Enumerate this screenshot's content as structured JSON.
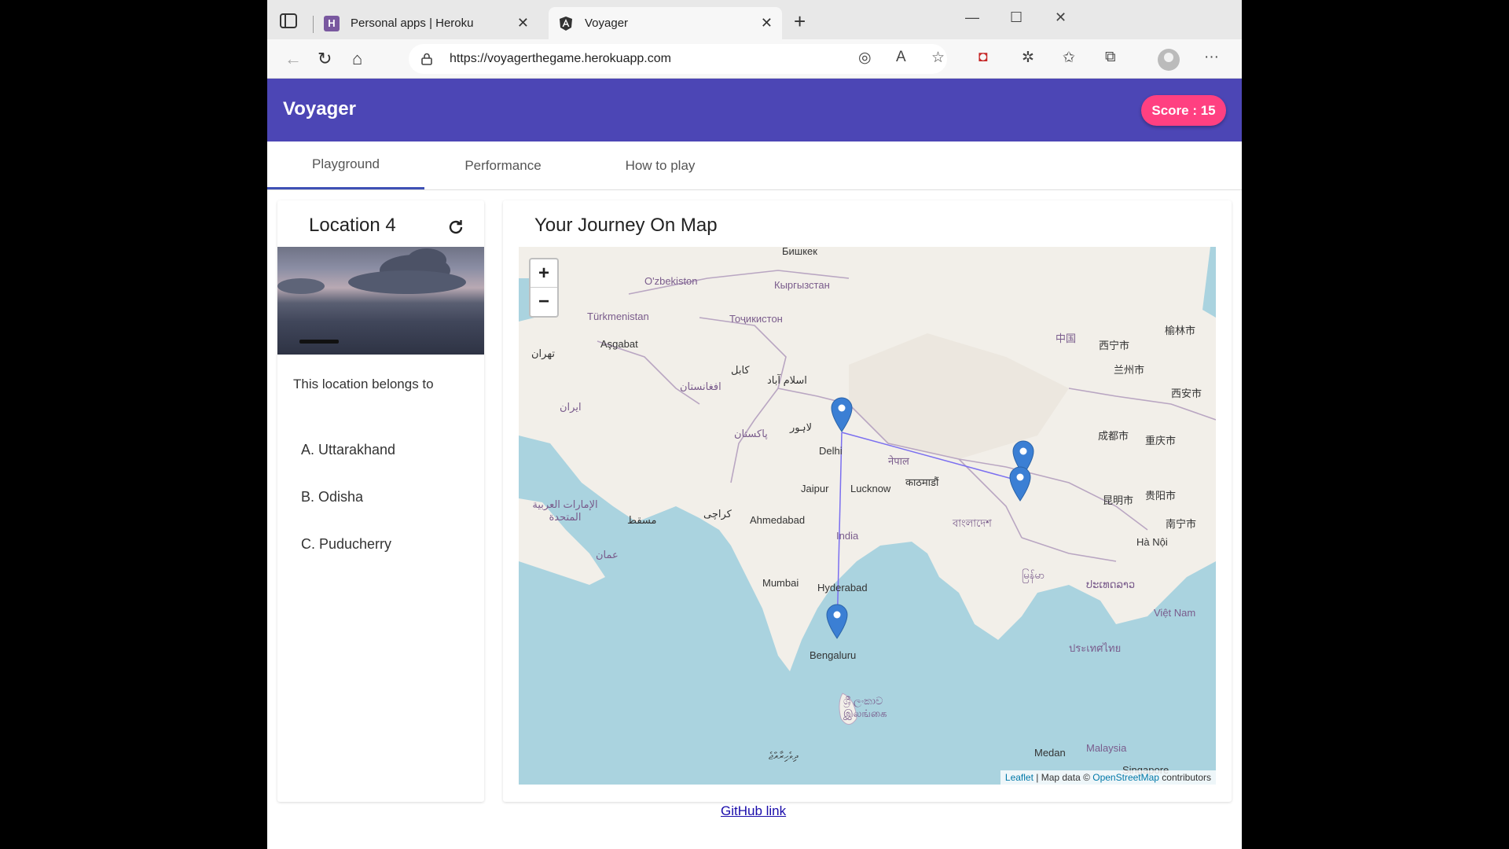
{
  "browser": {
    "tabs": [
      {
        "title": "Personal apps | Heroku",
        "favicon": "heroku-icon",
        "active": false
      },
      {
        "title": "Voyager",
        "favicon": "angular-icon",
        "active": true
      }
    ],
    "url": "https://voyagerthegame.herokuapp.com"
  },
  "app": {
    "title": "Voyager",
    "score_label": "Score : 15",
    "accent": "#4c46b5",
    "score_color": "#ff4081"
  },
  "nav": {
    "tabs": [
      {
        "label": "Playground",
        "selected": true
      },
      {
        "label": "Performance",
        "selected": false
      },
      {
        "label": "How to play",
        "selected": false
      }
    ]
  },
  "question": {
    "title": "Location 4",
    "prompt": "This location belongs to",
    "options": [
      "A. Uttarakhand",
      "B. Odisha",
      "C. Puducherry"
    ]
  },
  "map": {
    "title": "Your Journey On Map",
    "zoom_in": "+",
    "zoom_out": "−",
    "attribution": {
      "leaflet": "Leaflet",
      "middle": " | Map data © ",
      "osm": "OpenStreetMap",
      "end": " contributors"
    },
    "labels": {
      "bishkek": "Бишкек",
      "uzbekistan": "O'zbekiston",
      "kyrgyzstan": "Кыргызстан",
      "turkmenistan": "Türkmenistan",
      "tajikistan": "Тоҷикистон",
      "ashgabat": "Aşgabat",
      "china": "中国",
      "xining": "西宁市",
      "lanzhou": "兰州市",
      "xian": "西安市",
      "yulin": "榆林市",
      "kabul": "كابل",
      "afghanistan": "افغانستان",
      "islamabad": "اسلام آباد",
      "tehran": "تهران",
      "iran": "ایران",
      "pakistan": "پاکستان",
      "lahore": "لاہور",
      "delhi": "Delhi",
      "nepal": "नेपाल",
      "kathmandu": "काठमाडौं",
      "chengdu": "成都市",
      "chongqing": "重庆市",
      "jaipur": "Jaipur",
      "lucknow": "Lucknow",
      "karachi": "کراچی",
      "ahmedabad": "Ahmedabad",
      "uae": "الإمارات العربية المتحدة",
      "muscat": "مسقط",
      "oman": "عمان",
      "india": "India",
      "bangladesh": "বাংলাদেশ",
      "kunming": "昆明市",
      "guiyang": "贵阳市",
      "nanning": "南宁市",
      "hanoi": "Hà Nội",
      "mumbai": "Mumbai",
      "hyderabad": "Hyderabad",
      "myanmar": "မြန်မာ",
      "laos": "ປະເທດລາວ",
      "vietnam": "Việt Nam",
      "bengaluru": "Bengaluru",
      "thailand": "ประเทศไทย",
      "srilanka": "ශ්‍රී ලංකාව இலங்கை",
      "maldives": "ދިވެހިރާއްޖެ",
      "medan": "Medan",
      "malaysia": "Malaysia",
      "singapore": "Singapore"
    }
  },
  "footer": {
    "github_link": "GitHub link"
  }
}
